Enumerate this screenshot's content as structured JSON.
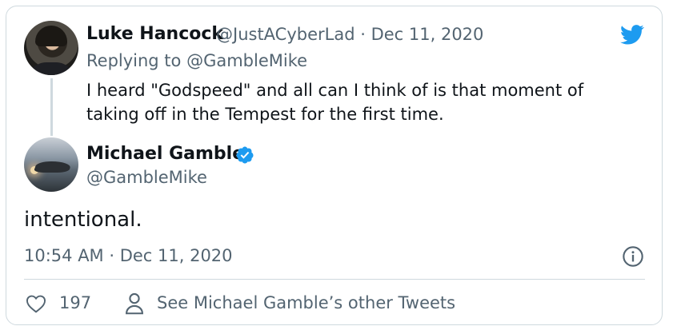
{
  "brand": {
    "accent": "#1d9bf0",
    "text": "#0f1419",
    "muted": "#536471",
    "border": "#cfd9de"
  },
  "reply_tweet": {
    "author_name": "Luke Hancock",
    "handle_date": "@JustACyberLad · Dec 11, 2020",
    "replying_to": "Replying to @GambleMike",
    "text": "I heard \"Godspeed\" and all can I think of is that moment of taking off in the Tempest for the first time."
  },
  "main_tweet": {
    "author_name": "Michael Gamble",
    "handle": "@GambleMike",
    "verified": true,
    "text": "intentional.",
    "timestamp": "10:54 AM · Dec 11, 2020"
  },
  "actions": {
    "like_count": "197",
    "other_tweets_label": "See Michael Gamble’s other Tweets"
  },
  "icons": {
    "logo": "twitter-bird-icon",
    "verified": "verified-badge-icon",
    "info": "info-icon",
    "like": "heart-icon",
    "profile": "person-icon"
  }
}
